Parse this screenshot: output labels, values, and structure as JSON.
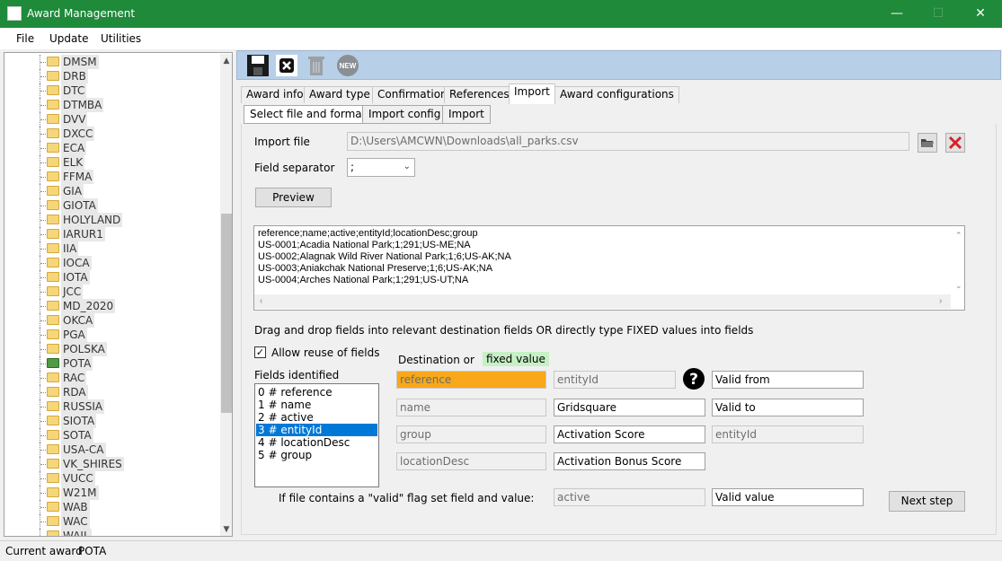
{
  "window": {
    "title": "Award Management"
  },
  "menu": [
    "File",
    "Update",
    "Utilities"
  ],
  "tree": {
    "items": [
      "DMSM",
      "DRB",
      "DTC",
      "DTMBA",
      "DVV",
      "DXCC",
      "ECA",
      "ELK",
      "FFMA",
      "GIA",
      "GIOTA",
      "HOLYLAND",
      "IARUR1",
      "IIA",
      "IOCA",
      "IOTA",
      "JCC",
      "MD_2020",
      "OKCA",
      "PGA",
      "POLSKA",
      "POTA",
      "RAC",
      "RDA",
      "RUSSIA",
      "SIOTA",
      "SOTA",
      "USA-CA",
      "VK_SHIRES",
      "VUCC",
      "W21M",
      "WAB",
      "WAC",
      "WAIL"
    ],
    "selected": "POTA"
  },
  "toolbar": {
    "icons": [
      "save-icon",
      "close-icon",
      "trash-icon",
      "new-icon"
    ]
  },
  "tabs": [
    "Award info",
    "Award type",
    "Confirmation",
    "References",
    "Import",
    "Award configurations"
  ],
  "active_tab": "Import",
  "subtabs": [
    "Select file and format",
    "Import config",
    "Import"
  ],
  "active_subtab": "Select file and format",
  "import": {
    "file_label": "Import file",
    "file_value": "D:\\Users\\AMCWN\\Downloads\\all_parks.csv",
    "sep_label": "Field separator",
    "sep_value": ";",
    "preview_button": "Preview",
    "preview_lines": [
      "reference;name;active;entityId;locationDesc;group",
      "US-0001;Acadia National Park;1;291;US-ME;NA",
      "US-0002;Alagnak Wild River National Park;1;6;US-AK;NA",
      "US-0003;Aniakchak National Preserve;1;6;US-AK;NA",
      "US-0004;Arches National Park;1;291;US-UT;NA"
    ]
  },
  "mapping": {
    "instruction": "Drag and drop fields into relevant destination fields OR directly type FIXED values into fields",
    "allow_reuse": "Allow reuse of fields",
    "fields_label": "Fields identified",
    "fields": [
      "0 # reference",
      "1 # name",
      "2 # active",
      "3 # entityId",
      "4 # locationDesc",
      "5 # group"
    ],
    "selected_field": "3 # entityId",
    "dest_label": "Destination or",
    "fixed_label": "fixed value",
    "col1": [
      "reference",
      "name",
      "group",
      "locationDesc"
    ],
    "col2": [
      "entityId",
      "Gridsquare",
      "Activation Score",
      "Activation Bonus Score"
    ],
    "col3": [
      "Valid from",
      "Valid to",
      "entityId"
    ],
    "valid_flag_label": "If file contains a \"valid\" flag set field and value:",
    "valid_field": "active",
    "valid_value": "Valid value",
    "next_button": "Next step"
  },
  "status": {
    "label": "Current award",
    "value": "POTA"
  },
  "colors": {
    "titlebar": "#1e8a3a",
    "selection": "#0078d7",
    "fixed": "#c6f0c6",
    "orange": "#f8a81a"
  }
}
